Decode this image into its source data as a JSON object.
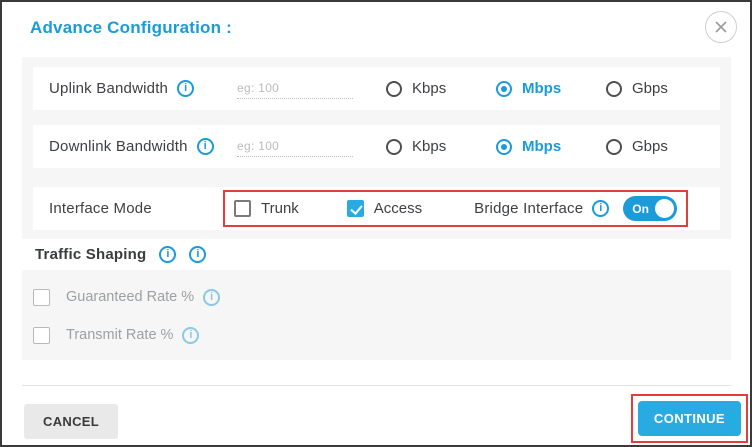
{
  "header": {
    "title": "Advance Configuration :"
  },
  "bandwidth_rows": [
    {
      "label": "Uplink Bandwidth",
      "value": "",
      "placeholder": "eg: 100",
      "units": [
        {
          "label": "Kbps",
          "selected": false
        },
        {
          "label": "Mbps",
          "selected": true
        },
        {
          "label": "Gbps",
          "selected": false
        }
      ]
    },
    {
      "label": "Downlink Bandwidth",
      "value": "",
      "placeholder": "eg: 100",
      "units": [
        {
          "label": "Kbps",
          "selected": false
        },
        {
          "label": "Mbps",
          "selected": true
        },
        {
          "label": "Gbps",
          "selected": false
        }
      ]
    }
  ],
  "interface_mode": {
    "label": "Interface Mode",
    "options": [
      {
        "label": "Trunk",
        "checked": false
      },
      {
        "label": "Access",
        "checked": true
      }
    ],
    "bridge_label": "Bridge Interface",
    "toggle_label": "On",
    "toggle_state": "on"
  },
  "traffic_shaping": {
    "label": "Traffic Shaping",
    "options": [
      {
        "label": "Guaranteed Rate %",
        "checked": false,
        "disabled": true
      },
      {
        "label": "Transmit Rate %",
        "checked": false,
        "disabled": true
      }
    ]
  },
  "footer": {
    "cancel_label": "CANCEL",
    "continue_label": "CONTINUE"
  },
  "colors": {
    "primary_blue": "#1B9BD7",
    "accent_cyan": "#29ABE2",
    "annotation_red": "#E0403C",
    "panel_gray": "#F6F6F6",
    "disabled_gray": "#9DA0A3"
  }
}
